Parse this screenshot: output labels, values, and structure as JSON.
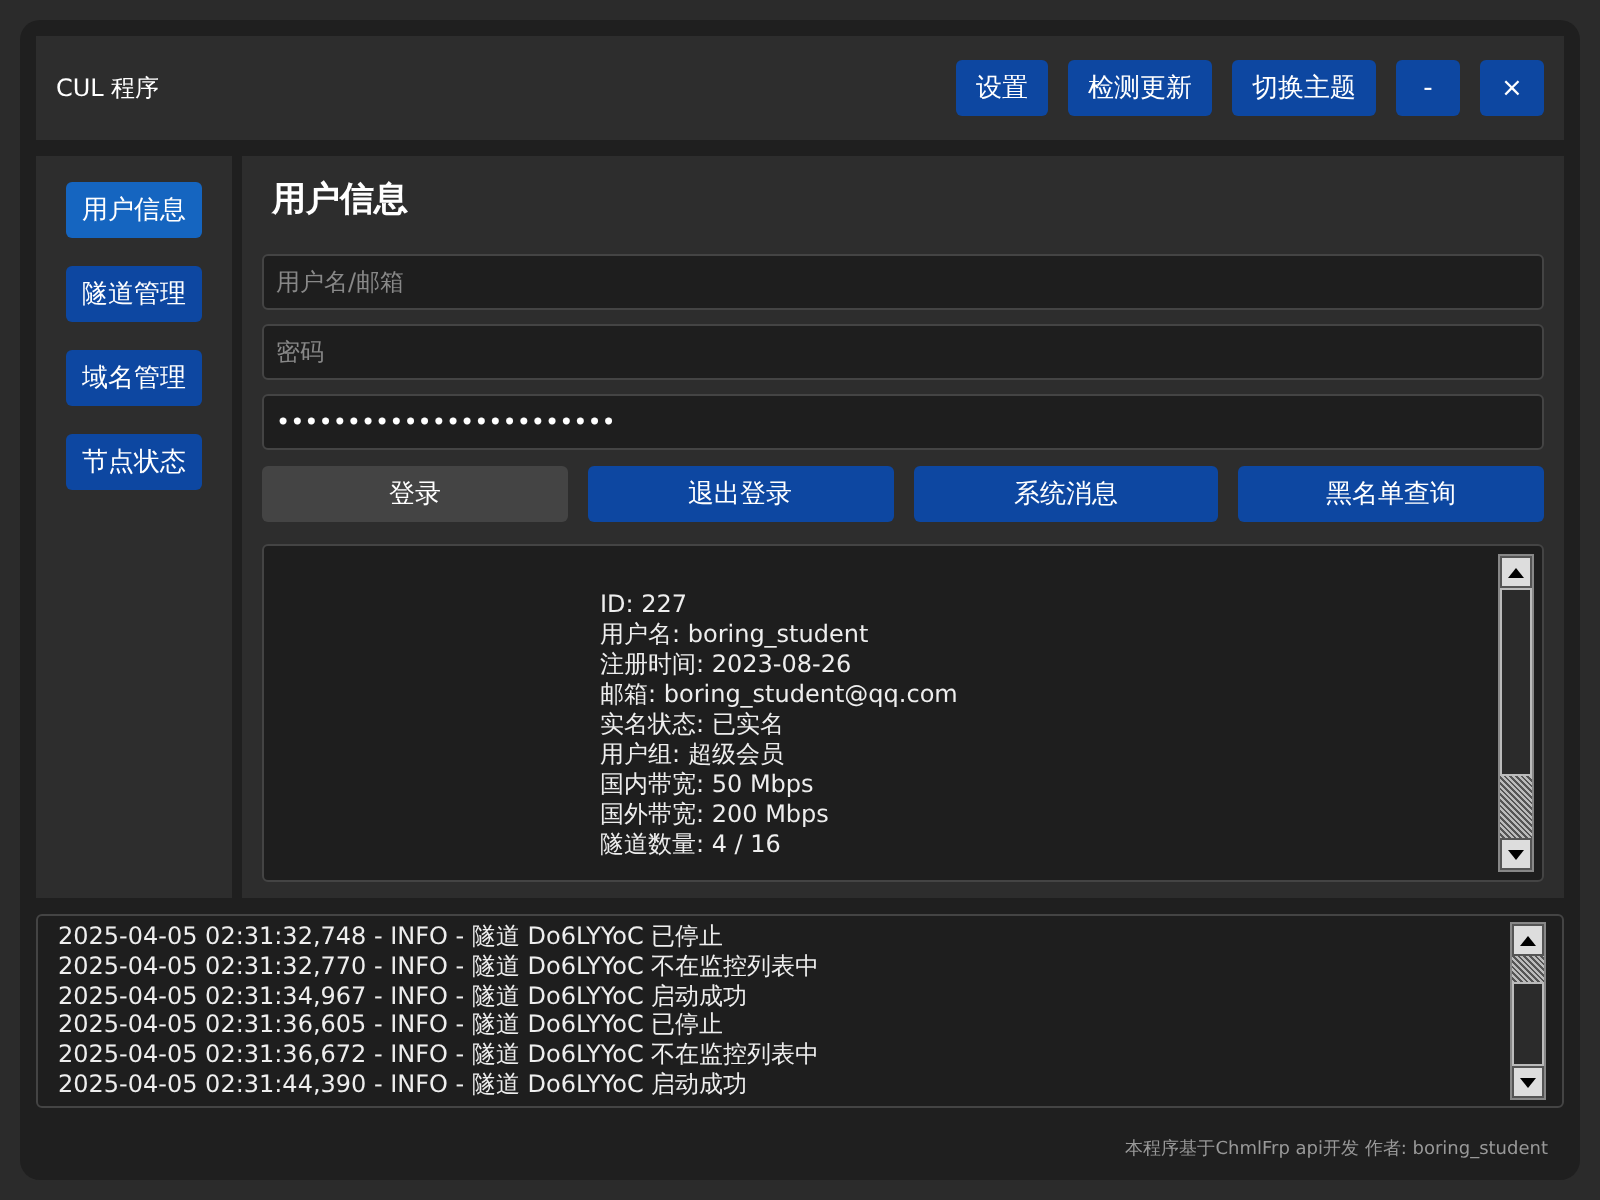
{
  "window": {
    "title": "CUL 程序"
  },
  "header_buttons": [
    "设置",
    "检测更新",
    "切换主题",
    "-",
    "×"
  ],
  "sidebar": {
    "items": [
      {
        "label": "用户信息",
        "selected": true
      },
      {
        "label": "隧道管理",
        "selected": false
      },
      {
        "label": "域名管理",
        "selected": false
      },
      {
        "label": "节点状态",
        "selected": false
      }
    ]
  },
  "main": {
    "heading": "用户信息",
    "fields": [
      {
        "placeholder": "用户名/邮箱"
      },
      {
        "placeholder": "密码"
      },
      {
        "value": "••••••••••••••••••••••••"
      }
    ],
    "buttons": [
      {
        "label": "登录",
        "disabled": true
      },
      {
        "label": "退出登录",
        "disabled": false
      },
      {
        "label": "系统消息",
        "disabled": false
      },
      {
        "label": "黑名单查询",
        "disabled": false
      }
    ],
    "info_lines": [
      "ID: 227",
      "用户名: boring_student",
      "注册时间: 2023-08-26",
      "邮箱: boring_student@qq.com",
      "实名状态: 已实名",
      "用户组: 超级会员",
      "国内带宽: 50 Mbps",
      "国外带宽: 200 Mbps",
      "隧道数量: 4 / 16"
    ]
  },
  "log": {
    "lines": [
      "2025-04-05 02:31:32,748 - INFO - 隧道 Do6LYYoC 已停止",
      "2025-04-05 02:31:32,770 - INFO - 隧道 Do6LYYoC 不在监控列表中",
      "2025-04-05 02:31:34,967 - INFO - 隧道 Do6LYYoC 启动成功",
      "2025-04-05 02:31:36,605 - INFO - 隧道 Do6LYYoC 已停止",
      "2025-04-05 02:31:36,672 - INFO - 隧道 Do6LYYoC 不在监控列表中",
      "2025-04-05 02:31:44,390 - INFO - 隧道 Do6LYYoC 启动成功"
    ]
  },
  "footer": "本程序基于ChmlFrp api开发 作者: boring_student"
}
